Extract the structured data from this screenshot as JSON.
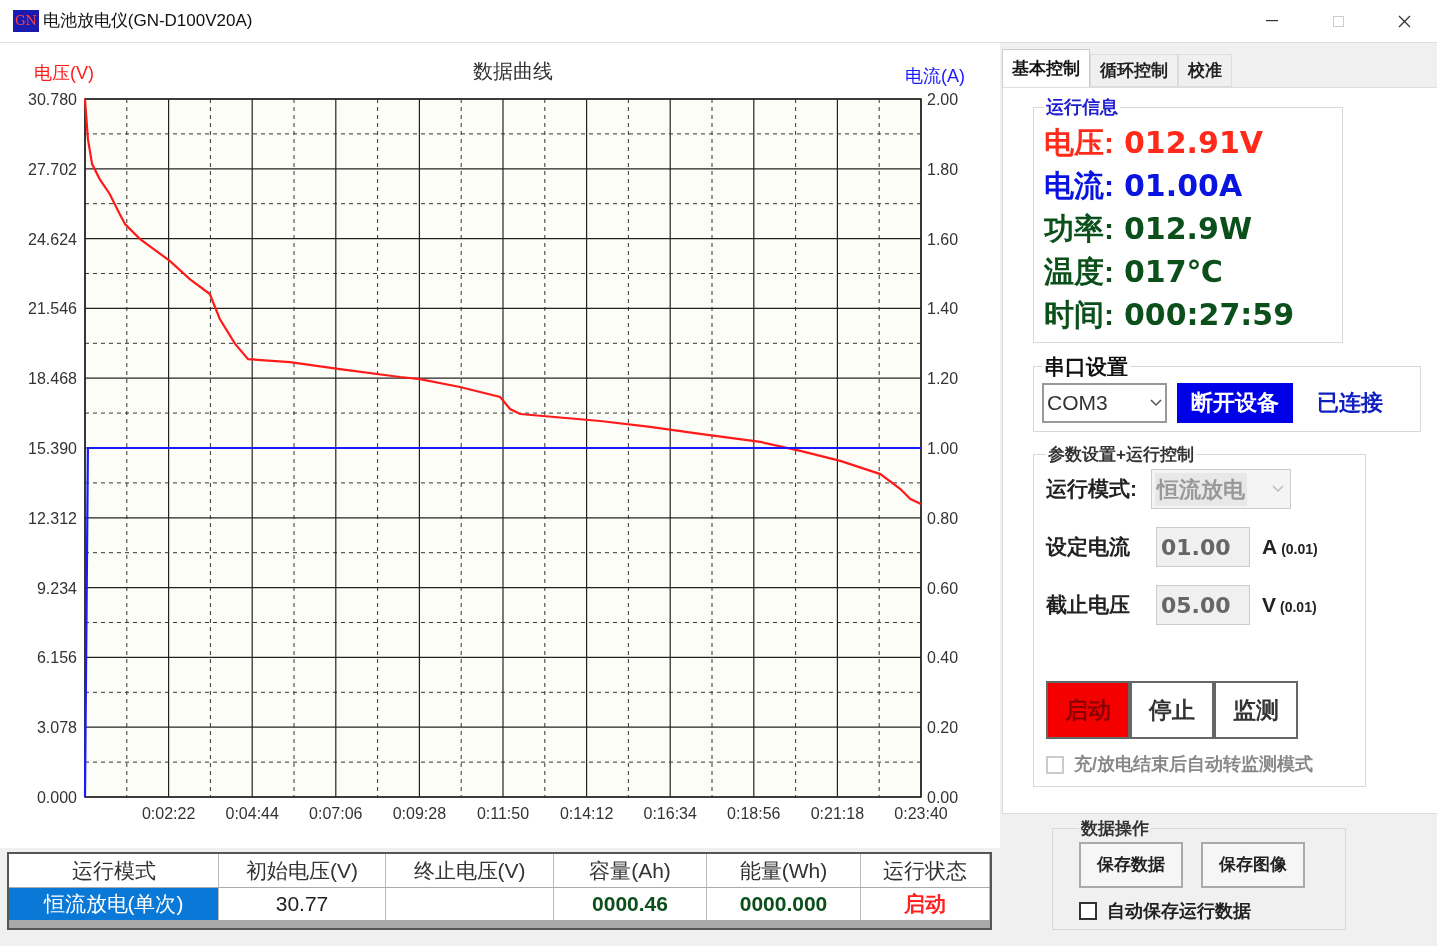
{
  "window": {
    "title": "电池放电仪(GN-D100V20A)",
    "logo": "GN"
  },
  "chart": {
    "chart_data": {
      "type": "line",
      "grid": true,
      "title": "数据曲线",
      "xlim": [
        0,
        1420
      ],
      "ylim": [
        0,
        30.78
      ],
      "y2lim": [
        0,
        2
      ],
      "x": [
        0,
        5,
        12,
        25,
        42,
        59,
        68,
        93,
        144,
        178,
        212,
        229,
        255,
        277,
        348,
        433,
        535,
        569,
        637,
        705,
        722,
        739,
        875,
        960,
        1045,
        1147,
        1215,
        1283,
        1351,
        1385,
        1402,
        1420
      ],
      "series": [
        {
          "name": "电压(V)",
          "color": "#ff1a1a",
          "values": [
            30.78,
            29.02,
            27.91,
            27.25,
            26.59,
            25.71,
            25.27,
            24.61,
            23.64,
            22.84,
            22.18,
            21.08,
            19.98,
            19.31,
            19.18,
            18.87,
            18.52,
            18.43,
            18.08,
            17.64,
            17.11,
            16.89,
            16.58,
            16.32,
            16.01,
            15.66,
            15.26,
            14.82,
            14.24,
            13.58,
            13.14,
            12.92
          ]
        },
        {
          "name": "电流(A)",
          "color": "#1a1aff",
          "axis": "y2",
          "values": [
            0,
            1,
            1,
            1,
            1,
            1,
            1,
            1,
            1,
            1,
            1,
            1,
            1,
            1,
            1,
            1,
            1,
            1,
            1,
            1,
            1,
            1,
            1,
            1,
            1,
            1,
            1,
            1,
            1,
            1,
            1,
            1
          ]
        }
      ],
      "xticks": [
        {
          "value": 142,
          "label": "0:02:22"
        },
        {
          "value": 284,
          "label": "0:04:44"
        },
        {
          "value": 426,
          "label": "0:07:06"
        },
        {
          "value": 568,
          "label": "0:09:28"
        },
        {
          "value": 710,
          "label": "0:11:50"
        },
        {
          "value": 852,
          "label": "0:14:12"
        },
        {
          "value": 994,
          "label": "0:16:34"
        },
        {
          "value": 1136,
          "label": "0:18:56"
        },
        {
          "value": 1278,
          "label": "0:21:18"
        },
        {
          "value": 1420,
          "label": "0:23:40"
        }
      ],
      "yticks": [
        {
          "value": 0,
          "label": "0.000"
        },
        {
          "value": 3.078,
          "label": "3.078"
        },
        {
          "value": 6.156,
          "label": "6.156"
        },
        {
          "value": 9.234,
          "label": "9.234"
        },
        {
          "value": 12.312,
          "label": "12.312"
        },
        {
          "value": 15.39,
          "label": "15.390"
        },
        {
          "value": 18.468,
          "label": "18.468"
        },
        {
          "value": 21.546,
          "label": "21.546"
        },
        {
          "value": 24.624,
          "label": "24.624"
        },
        {
          "value": 27.702,
          "label": "27.702"
        },
        {
          "value": 30.78,
          "label": "30.780"
        }
      ],
      "y2ticks": [
        {
          "value": 0,
          "label": "0.00"
        },
        {
          "value": 0.2,
          "label": "0.20"
        },
        {
          "value": 0.4,
          "label": "0.40"
        },
        {
          "value": 0.6,
          "label": "0.60"
        },
        {
          "value": 0.8,
          "label": "0.80"
        },
        {
          "value": 1,
          "label": "1.00"
        },
        {
          "value": 1.2,
          "label": "1.20"
        },
        {
          "value": 1.4,
          "label": "1.40"
        },
        {
          "value": 1.6,
          "label": "1.60"
        },
        {
          "value": 1.8,
          "label": "1.80"
        },
        {
          "value": 2,
          "label": "2.00"
        }
      ]
    }
  },
  "table": {
    "columns": [
      "运行模式",
      "初始电压(V)",
      "终止电压(V)",
      "容量(Ah)",
      "能量(Wh)",
      "运行状态"
    ],
    "row": [
      {
        "text": "恒流放电(单次)",
        "kind": "plain",
        "selected": true
      },
      {
        "text": "30.77",
        "kind": "plain",
        "selected": false
      },
      {
        "kind": "plain",
        "selected": false
      },
      {
        "text": "0000.46",
        "kind": "value",
        "selected": false
      },
      {
        "text": "0000.000",
        "kind": "value",
        "selected": false
      },
      {
        "text": "启动",
        "kind": "status",
        "selected": false
      }
    ]
  },
  "tabs": [
    {
      "label": "基本控制",
      "selected": true
    },
    {
      "label": "循环控制",
      "selected": false
    },
    {
      "label": "校准",
      "selected": false
    }
  ],
  "run_info": {
    "title": "运行信息",
    "items": [
      {
        "label": "电压:",
        "value": "012.91V",
        "color": "#ff2a1a"
      },
      {
        "label": "电流:",
        "value": "01.00A",
        "color": "#0a14e0"
      },
      {
        "label": "功率:",
        "value": "012.9W",
        "color": "#0b4f1b"
      },
      {
        "label": "温度:",
        "value": "017℃",
        "color": "#0b4f1b"
      },
      {
        "label": "时间:",
        "value": "000:27:59",
        "color": "#0b4f1b"
      }
    ]
  },
  "serial": {
    "title": "串口设置",
    "port": "COM3",
    "button": "断开设备",
    "status": "已连接"
  },
  "params": {
    "title": "参数设置+运行控制",
    "mode_label": "运行模式:",
    "mode": "恒流放电",
    "mode_disabled": true,
    "fields": [
      {
        "label": "设定电流",
        "value": "01.00",
        "unit": "A",
        "step": "(0.01)",
        "disabled": true
      },
      {
        "label": "截止电压",
        "value": "05.00",
        "unit": "V",
        "step": "(0.01)",
        "disabled": true
      }
    ],
    "buttons": [
      {
        "label": "启动",
        "active": true
      },
      {
        "label": "停止",
        "active": false
      },
      {
        "label": "监测",
        "active": false
      }
    ],
    "auto_monitor": {
      "label": "充/放电结束后自动转监测模式",
      "checked": false,
      "disabled": true
    }
  },
  "data_ops": {
    "title": "数据操作",
    "buttons": [
      "保存数据",
      "保存图像"
    ],
    "auto_save": {
      "label": "自动保存运行数据",
      "checked": false
    }
  }
}
